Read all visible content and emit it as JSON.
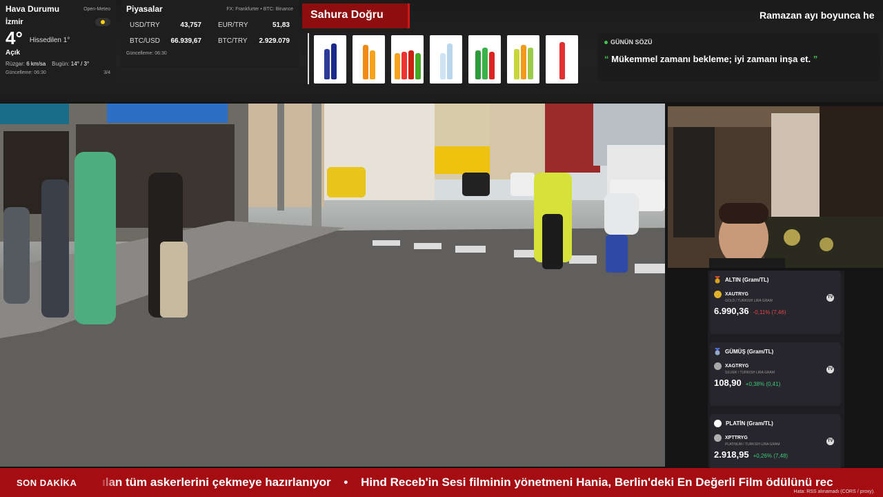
{
  "weather": {
    "title": "Hava Durumu",
    "source": "Open-Meteo",
    "city": "İzmir",
    "temp": "4°",
    "feels_like": "Hissedilen 1°",
    "condition": "Açık",
    "wind_label": "Rüzgar:",
    "wind": "6 km/sa",
    "today_label": "Bugün:",
    "today": "14° / 3°",
    "updated": "Güncelleme: 06:30",
    "page": "3/4",
    "icon": "sun-icon"
  },
  "markets": {
    "title": "Piyasalar",
    "source": "FX: Frankfurter • BTC: Binance",
    "rates": [
      {
        "pair": "USD/TRY",
        "value": "43,757"
      },
      {
        "pair": "EUR/TRY",
        "value": "51,83"
      },
      {
        "pair": "BTC/USD",
        "value": "66.939,67"
      },
      {
        "pair": "BTC/TRY",
        "value": "2.929.079"
      }
    ],
    "updated": "Güncelleme: 06:30"
  },
  "sahur": {
    "title": "Sahura Doğru"
  },
  "marquee_top": "Ramazan ayı boyunca he",
  "quote": {
    "title": "GÜNÜN SÖZÜ",
    "open": "“",
    "text": "Mükemmel zamanı bekleme; iyi zamanı inşa et.",
    "close": "”"
  },
  "metals": [
    {
      "title": "ALTIN (Gram/TL)",
      "symbol": "XAUTRYG",
      "sub": "GOLD / TURKISH LIRA GRAM",
      "price": "6.990,36",
      "change": "-0,11% (7,46)",
      "direction": "down",
      "medal_color": "#d9a21b",
      "coin_color": "#e0b12a",
      "icon": "gold-medal-icon"
    },
    {
      "title": "GÜMÜŞ (Gram/TL)",
      "symbol": "XAGTRYG",
      "sub": "SILVER / TURKISH LIRA GRAM",
      "price": "108,90",
      "change": "+0,38% (0,41)",
      "direction": "up",
      "medal_color": "#9aa7c8",
      "coin_color": "#a8a8a8",
      "icon": "silver-medal-icon"
    },
    {
      "title": "PLATİN (Gram/TL)",
      "symbol": "XPTTRYG",
      "sub": "PLATINUM / TURKISH LIRA GRAM",
      "price": "2.918,95",
      "change": "+0,26% (7,48)",
      "direction": "up",
      "medal_color": "#ffffff",
      "coin_color": "#b0b0b0",
      "icon": "platinum-dot-icon"
    }
  ],
  "ticker": {
    "label": "SON DAKİKA",
    "items": [
      "ılan tüm askerlerini çekmeye hazırlanıyor",
      "Hind Receb'in Sesi filminin yönetmeni Hania, Berlin'deki En Değerli Film ödülünü rec"
    ],
    "separator": "•",
    "error": "Hata: RSS alınamadı (CORS / proxy)."
  },
  "colors": {
    "accent_red": "#a50d12",
    "quote_green": "#41c24b",
    "down": "#e2474b",
    "up": "#3ec97a"
  }
}
